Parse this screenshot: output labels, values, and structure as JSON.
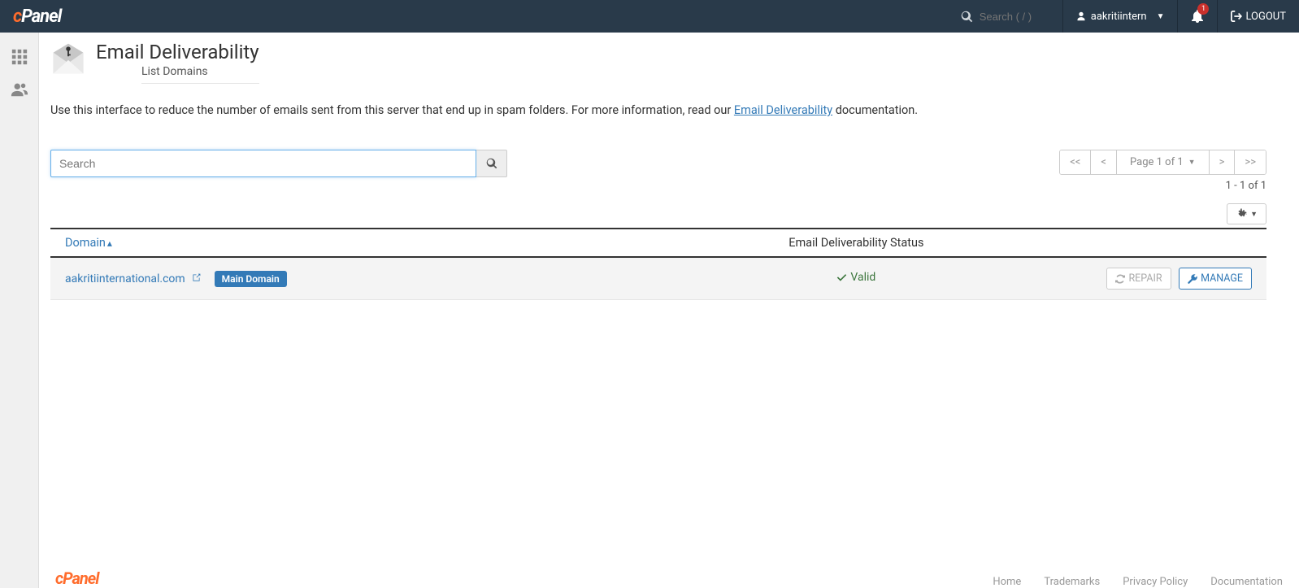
{
  "brand": "cPanel",
  "navbar": {
    "search_placeholder": "Search ( / )",
    "username": "aakritiintern",
    "notification_count": "1",
    "logout_label": "LOGOUT"
  },
  "page": {
    "title": "Email Deliverability",
    "subtitle": "List Domains",
    "description_pre": "Use this interface to reduce the number of emails sent from this server that end up in spam folders. For more information, read our ",
    "description_link": "Email Deliverability",
    "description_post": " documentation."
  },
  "search": {
    "placeholder": "Search"
  },
  "pager": {
    "first": "<<",
    "prev": "<",
    "info": "Page 1 of 1",
    "next": ">",
    "last": ">>",
    "result_count": "1 - 1 of 1"
  },
  "table": {
    "columns": {
      "domain": "Domain",
      "status": "Email Deliverability Status"
    },
    "rows": [
      {
        "domain": "aakritiinternational.com",
        "badge": "Main Domain",
        "status": "Valid",
        "repair_label": "REPAIR",
        "manage_label": "MANAGE"
      }
    ]
  },
  "footer": {
    "brand": "cPanel",
    "links": [
      "Home",
      "Trademarks",
      "Privacy Policy",
      "Documentation"
    ]
  }
}
